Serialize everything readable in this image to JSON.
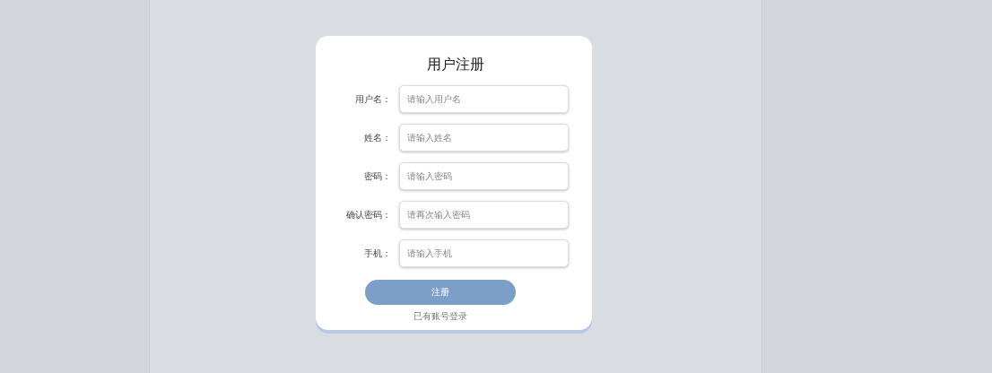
{
  "form": {
    "title": "用户注册",
    "fields": [
      {
        "label": "用户名：",
        "placeholder": "请输入用户名"
      },
      {
        "label": "姓名：",
        "placeholder": "请输入姓名"
      },
      {
        "label": "密码：",
        "placeholder": "请输入密码"
      },
      {
        "label": "确认密码：",
        "placeholder": "请再次输入密码"
      },
      {
        "label": "手机：",
        "placeholder": "请输入手机"
      }
    ],
    "submit": "注册",
    "login_link": "已有账号登录"
  }
}
